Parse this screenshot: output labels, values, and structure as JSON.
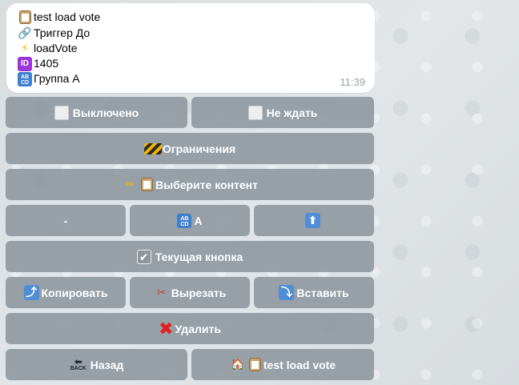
{
  "message": {
    "lines": [
      {
        "icon": "clipboard-icon",
        "text": "test load vote"
      },
      {
        "icon": "link-icon",
        "text": "Триггер До"
      },
      {
        "icon": "lightning-icon",
        "text": "loadVote"
      },
      {
        "icon": "id-icon",
        "icon_text": "ID",
        "text": " 1405"
      },
      {
        "icon": "abcd-icon",
        "icon_text": "AB\nCD",
        "text": "Группа А"
      }
    ],
    "time": "11:39"
  },
  "keyboard": {
    "off_label": "Выключено",
    "no_wait_label": "Не ждать",
    "restrictions_label": "Ограничения",
    "select_content_label": "Выберите контент",
    "dash_label": "-",
    "abcd_a_label": "A",
    "up_arrow_icon": "up-arrow-icon",
    "current_button_label": "Текущая кнопка",
    "copy_label": "Копировать",
    "cut_label": "Вырезать",
    "paste_label": "Вставить",
    "delete_label": "Удалить",
    "back_label": "Назад",
    "back_icon_text": "BACK",
    "test_load_vote_label": "test load vote"
  },
  "colors": {
    "button_bg": "#8c969d",
    "bubble_bg": "#ffffff",
    "time_text": "#9aa1a6",
    "delete_x": "#e02020"
  }
}
